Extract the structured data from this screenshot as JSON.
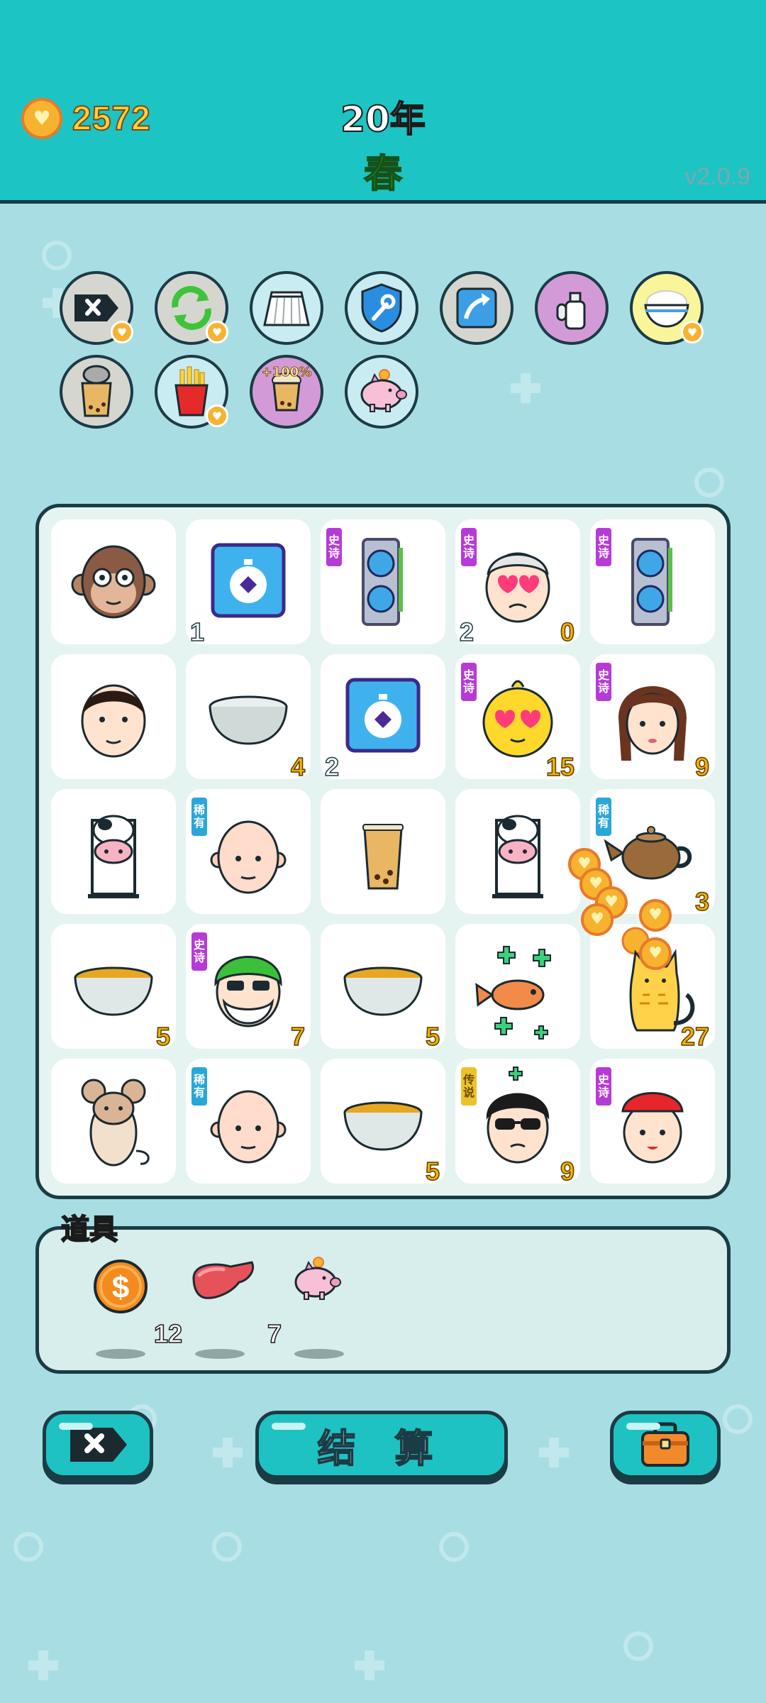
{
  "header": {
    "coins": "2572",
    "year": "20年",
    "season": "春",
    "version": "v2.0.9"
  },
  "buffs": [
    {
      "name": "remove-icon",
      "bg": "#d6d6d0"
    },
    {
      "name": "refresh-icon",
      "bg": "#d6d6d0"
    },
    {
      "name": "skirt-icon",
      "bg": "#c9ecf2"
    },
    {
      "name": "shield-wrench-icon",
      "bg": "#c9ecf2"
    },
    {
      "name": "arrow-up-icon",
      "bg": "#d6d6d0"
    },
    {
      "name": "perfume-icon",
      "bg": "#d39ad8"
    },
    {
      "name": "rice-bowl-icon",
      "bg": "#f8f59a"
    },
    {
      "name": "bubble-tea-lid-icon",
      "bg": "#d6d6d0"
    },
    {
      "name": "fries-icon",
      "bg": "#c9ecf2"
    },
    {
      "name": "bubble-tea-boost-icon",
      "bg": "#d39ad8",
      "label": "+100%"
    },
    {
      "name": "piggy-bank-icon",
      "bg": "#c9ecf2"
    }
  ],
  "board": [
    {
      "name": "monkey-icon",
      "rarity": "",
      "count": "",
      "count_left": ""
    },
    {
      "name": "stopwatch-card-icon",
      "rarity": "",
      "count": "",
      "count_left": "1"
    },
    {
      "name": "gpu-card-icon",
      "rarity": "史诗",
      "count": "",
      "count_left": ""
    },
    {
      "name": "heart-eyes-grandpa-icon",
      "rarity": "史诗",
      "count": "0",
      "count_left": "2"
    },
    {
      "name": "gpu-card-icon",
      "rarity": "史诗",
      "count": "",
      "count_left": ""
    },
    {
      "name": "man-face-icon",
      "rarity": "",
      "count": "",
      "count_left": ""
    },
    {
      "name": "empty-bowl-icon",
      "rarity": "",
      "count": "4",
      "count_left": ""
    },
    {
      "name": "stopwatch-card-icon",
      "rarity": "",
      "count": "",
      "count_left": "2"
    },
    {
      "name": "heart-eyes-chick-icon",
      "rarity": "史诗",
      "count": "15",
      "count_left": ""
    },
    {
      "name": "braided-girl-icon",
      "rarity": "史诗",
      "count": "9",
      "count_left": ""
    },
    {
      "name": "cow-icon",
      "rarity": "",
      "count": "",
      "count_left": ""
    },
    {
      "name": "bald-man-icon",
      "rarity": "稀有",
      "count": "",
      "count_left": ""
    },
    {
      "name": "bubble-tea-icon",
      "rarity": "",
      "count": "",
      "count_left": ""
    },
    {
      "name": "cow-icon",
      "rarity": "",
      "count": "",
      "count_left": ""
    },
    {
      "name": "teapot-icon",
      "rarity": "稀有",
      "count": "3",
      "count_left": ""
    },
    {
      "name": "soup-bowl-icon",
      "rarity": "",
      "count": "5",
      "count_left": ""
    },
    {
      "name": "green-hair-grandpa-icon",
      "rarity": "史诗",
      "count": "7",
      "count_left": ""
    },
    {
      "name": "soup-bowl-icon",
      "rarity": "",
      "count": "5",
      "count_left": ""
    },
    {
      "name": "fish-clover-icon",
      "rarity": "",
      "count": "",
      "count_left": ""
    },
    {
      "name": "cat-icon",
      "rarity": "",
      "count": "27",
      "count_left": ""
    },
    {
      "name": "mouse-icon",
      "rarity": "",
      "count": "",
      "count_left": ""
    },
    {
      "name": "bald-man-icon",
      "rarity": "稀有",
      "count": "",
      "count_left": ""
    },
    {
      "name": "soup-bowl-icon",
      "rarity": "",
      "count": "5",
      "count_left": ""
    },
    {
      "name": "sunglasses-man-icon",
      "rarity": "传说",
      "count": "9",
      "count_left": ""
    },
    {
      "name": "red-hat-girl-icon",
      "rarity": "史诗",
      "count": "",
      "count_left": ""
    }
  ],
  "items": {
    "title": "道具",
    "list": [
      {
        "name": "dollar-coin-icon",
        "count": "12"
      },
      {
        "name": "liver-icon",
        "count": "7"
      },
      {
        "name": "piggy-bank-icon",
        "count": ""
      }
    ]
  },
  "buttons": {
    "settle": "结 算"
  },
  "colors": {
    "header": "#1dc4c4",
    "background": "#a9dde4",
    "epic": "#b63bd6",
    "rare": "#2aa7d9",
    "legend": "#ecc22a",
    "count": "#f5b400"
  }
}
